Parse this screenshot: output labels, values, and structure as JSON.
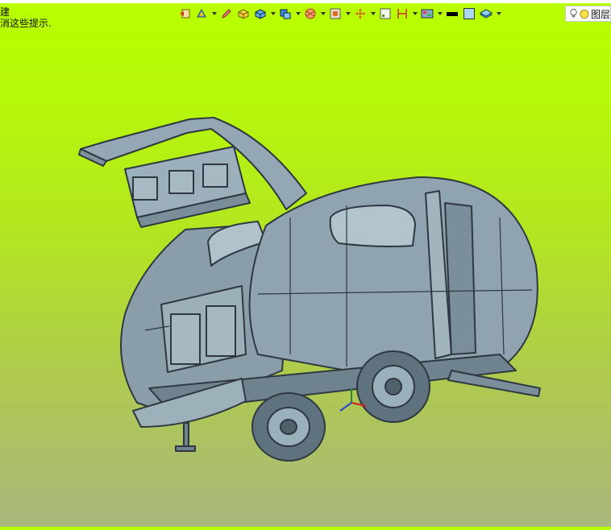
{
  "hint": {
    "line1": "建",
    "line2": "消这些提示."
  },
  "layer": {
    "label": "图层"
  },
  "toolbar": {
    "icons": [
      "previous-view-icon",
      "view-orientation-icon",
      "sketch-pencil-icon",
      "part-icon",
      "assembly-icon",
      "display-style-icon",
      "section-view-icon",
      "view-setting-icon",
      "hide-show-icon",
      "move-icon",
      "sketch-grid-icon",
      "dimension-icon",
      "appearance-icon",
      "line-color-icon",
      "fill-color-icon",
      "layer-stack-icon",
      "bulb-icon",
      "layer-on-icon"
    ]
  },
  "colors": {
    "accent": "#b9ff00",
    "model_fill": "#8ea2ae",
    "model_line": "#2f3840"
  }
}
